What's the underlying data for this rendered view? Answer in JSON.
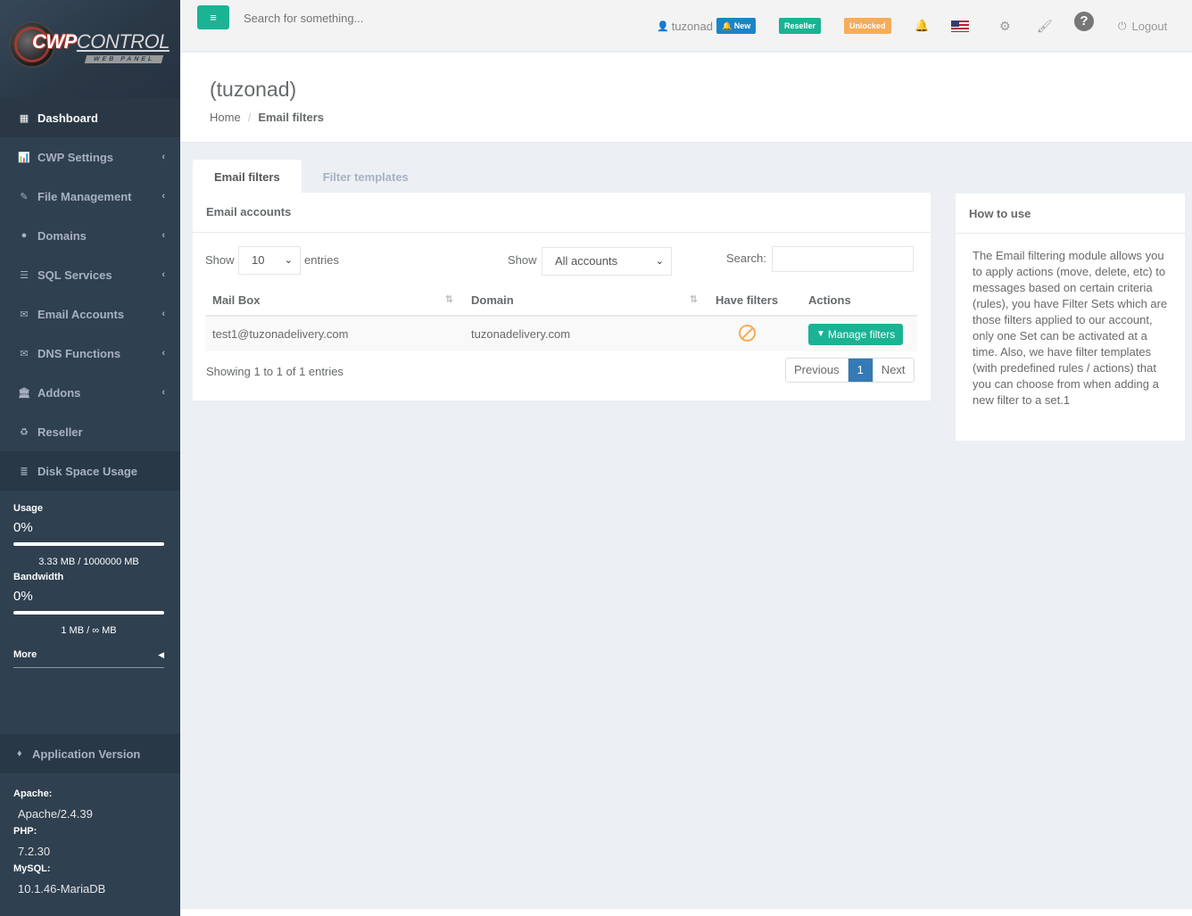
{
  "brand": {
    "logo_main": "CWP",
    "logo_control": "CONTROL",
    "logo_sub": "WEB PANEL"
  },
  "sidebar": {
    "items": [
      {
        "label": "Dashboard",
        "icon": "grid-icon",
        "glyph": "▦"
      },
      {
        "label": "CWP Settings",
        "icon": "bar-chart-icon",
        "glyph": "📊"
      },
      {
        "label": "File Management",
        "icon": "edit-icon",
        "glyph": "✎"
      },
      {
        "label": "Domains",
        "icon": "globe-icon",
        "glyph": "●"
      },
      {
        "label": "SQL Services",
        "icon": "database-icon",
        "glyph": "☰"
      },
      {
        "label": "Email Accounts",
        "icon": "envelope-icon",
        "glyph": "✉"
      },
      {
        "label": "DNS Functions",
        "icon": "envelope-icon",
        "glyph": "✉"
      },
      {
        "label": "Addons",
        "icon": "bank-icon",
        "glyph": "🏛"
      },
      {
        "label": "Reseller",
        "icon": "recycle-icon",
        "glyph": "♻"
      },
      {
        "label": "Disk Space Usage",
        "icon": "server-icon",
        "glyph": "≣"
      }
    ],
    "usage": {
      "label": "Usage",
      "percent": "0%",
      "fraction": 0,
      "amount": "3.33 MB / 1000000 MB"
    },
    "bandwidth": {
      "label": "Bandwidth",
      "percent": "0%",
      "fraction": 0,
      "amount": "1 MB / ∞ MB"
    },
    "more_label": "More",
    "app_version_label": "Application Version",
    "versions": [
      {
        "label": "Apache:",
        "value": "Apache/2.4.39"
      },
      {
        "label": "PHP:",
        "value": "7.2.30"
      },
      {
        "label": "MySQL:",
        "value": "10.1.46-MariaDB"
      }
    ]
  },
  "topbar": {
    "search_placeholder": "Search for something...",
    "username": "tuzonad",
    "badge_new": "New",
    "badge_reseller": "Reseller",
    "badge_unlocked": "Unlocked",
    "logout_label": "Logout"
  },
  "page": {
    "title": "(tuzonad)",
    "breadcrumb_home": "Home",
    "breadcrumb_current": "Email filters"
  },
  "tabs": [
    "Email filters",
    "Filter templates"
  ],
  "panel": {
    "title": "Email accounts",
    "show_label": "Show",
    "entries_value": "10",
    "entries_label": "entries",
    "show2_label": "Show",
    "accounts_value": "All accounts",
    "search_label": "Search:",
    "columns": [
      "Mail Box",
      "Domain",
      "Have filters",
      "Actions"
    ],
    "rows": [
      {
        "mailbox": "test1@tuzonadelivery.com",
        "domain": "tuzonadelivery.com",
        "action": "Manage filters"
      }
    ],
    "info": "Showing 1 to 1 of 1 entries",
    "pager": {
      "prev": "Previous",
      "current": "1",
      "next": "Next"
    }
  },
  "howto": {
    "title": "How to use",
    "body": "The Email filtering module allows you to apply actions (move, delete, etc) to messages based on certain criteria (rules), you have Filter Sets which are those filters applied to our account, only one Set can be activated at a time. Also, we have filter templates (with predefined rules / actions) that you can choose from when adding a new filter to a set.1"
  }
}
